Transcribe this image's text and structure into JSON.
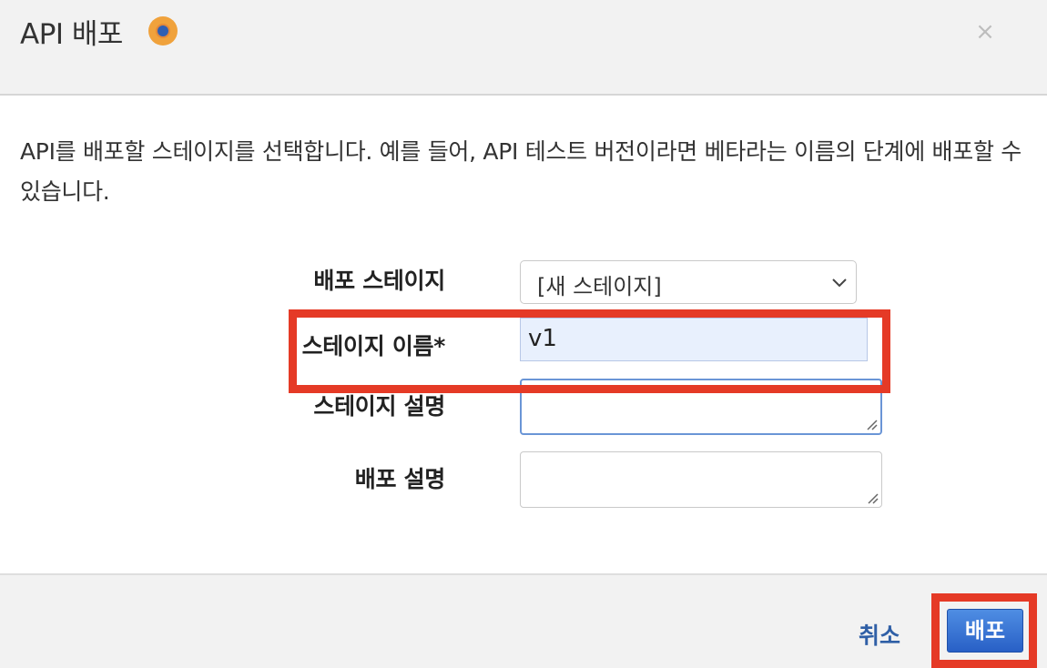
{
  "dialog": {
    "title": "API 배포",
    "close_symbol": "×",
    "description": "API를 배포할 스테이지를 선택합니다. 예를 들어, API 테스트 버전이라면 베타라는 이름의 단계에 배포할 수 있습니다."
  },
  "form": {
    "stage_label": "배포 스테이지",
    "stage_selected": "[새 스테이지]",
    "stage_name_label": "스테이지 이름*",
    "stage_name_value": "v1",
    "stage_desc_label": "스테이지 설명",
    "stage_desc_value": "",
    "deploy_desc_label": "배포 설명",
    "deploy_desc_value": ""
  },
  "footer": {
    "cancel_label": "취소",
    "deploy_label": "배포"
  },
  "colors": {
    "highlight": "#e53a26",
    "primary": "#2860c6",
    "link": "#2f5fa6",
    "status_icon": "#f0a23c"
  },
  "icons": [
    "status-icon",
    "close-icon",
    "chevron-down-icon",
    "resize-grip-icon"
  ]
}
